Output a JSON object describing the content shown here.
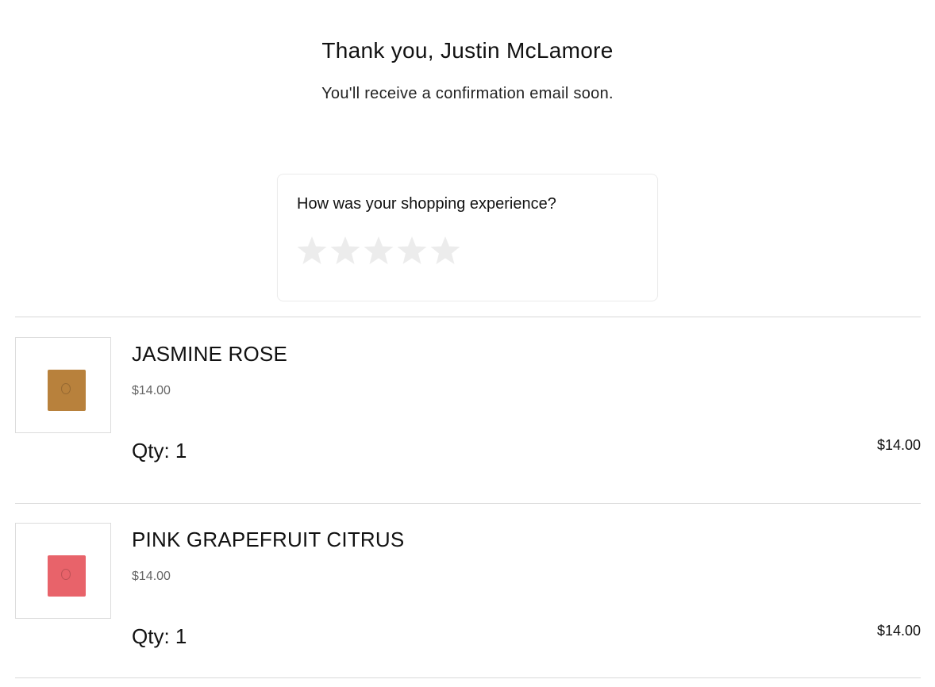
{
  "confirmation": {
    "title": "Thank you, Justin McLamore",
    "subtitle": "You'll receive a confirmation email soon."
  },
  "feedback": {
    "question": "How was your shopping experience?",
    "rating": 0,
    "max_rating": 5,
    "star_icon": "star-icon",
    "star_color_empty": "#ececec"
  },
  "items": [
    {
      "name": "JASMINE ROSE",
      "unit_price": "$14.00",
      "qty_label": "Qty: 1",
      "total": "$14.00",
      "image_icon": "soap-bar-image",
      "image_color": "#b8813c"
    },
    {
      "name": "PINK GRAPEFRUIT CITRUS",
      "unit_price": "$14.00",
      "qty_label": "Qty: 1",
      "total": "$14.00",
      "image_icon": "soap-bar-image",
      "image_color": "#e8636a"
    }
  ]
}
